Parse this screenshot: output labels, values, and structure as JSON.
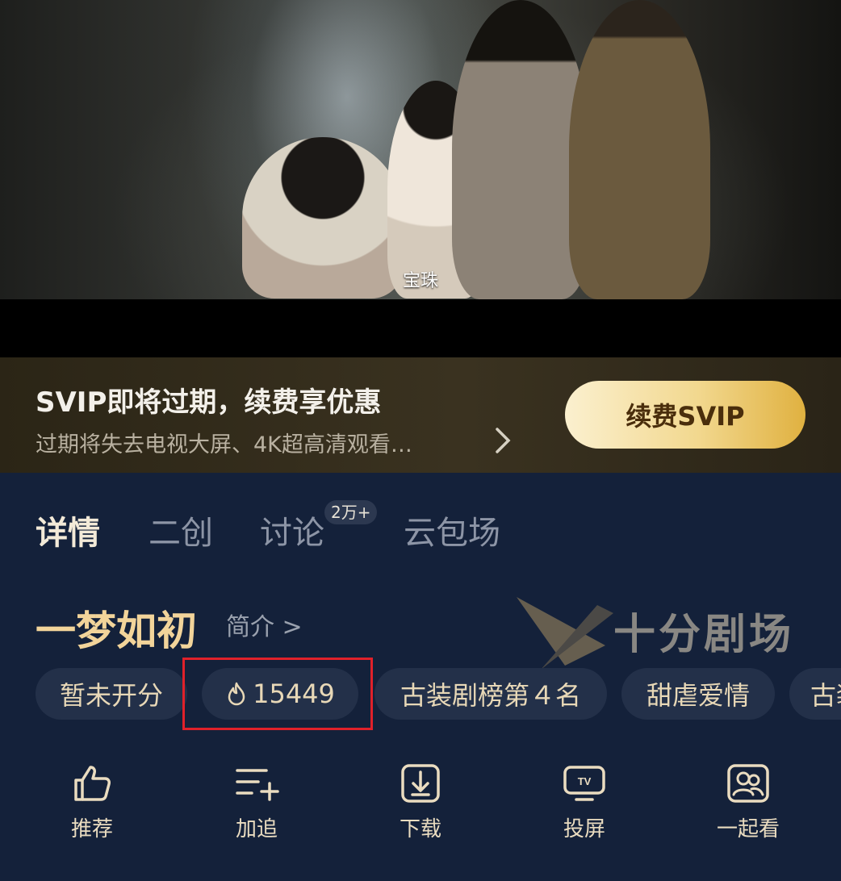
{
  "player": {
    "subtitle": "宝珠"
  },
  "promo": {
    "title": "SVIP即将过期，续费享优惠",
    "subtitle": "过期将失去电视大屏、4K超高清观看…",
    "button": "续费SVIP"
  },
  "tabs": [
    {
      "label": "详情",
      "active": true
    },
    {
      "label": "二创",
      "active": false
    },
    {
      "label": "讨论",
      "active": false,
      "badge": "2万+"
    },
    {
      "label": "云包场",
      "active": false
    }
  ],
  "show": {
    "title": "一梦如初",
    "intro_link": "简介 >"
  },
  "watermark": {
    "text": "十分剧场"
  },
  "tags": [
    "暂未开分",
    "15449",
    "古装剧榜第４名",
    "甜虐爱情",
    "古装"
  ],
  "actions": [
    {
      "label": "推荐",
      "icon": "thumbs-up-icon"
    },
    {
      "label": "加追",
      "icon": "add-list-icon"
    },
    {
      "label": "下载",
      "icon": "download-icon"
    },
    {
      "label": "投屏",
      "icon": "tv-cast-icon"
    },
    {
      "label": "一起看",
      "icon": "watch-together-icon"
    }
  ],
  "colors": {
    "accent_gold": "#f2d49a",
    "background": "#14213a",
    "highlight": "#e0212a"
  }
}
